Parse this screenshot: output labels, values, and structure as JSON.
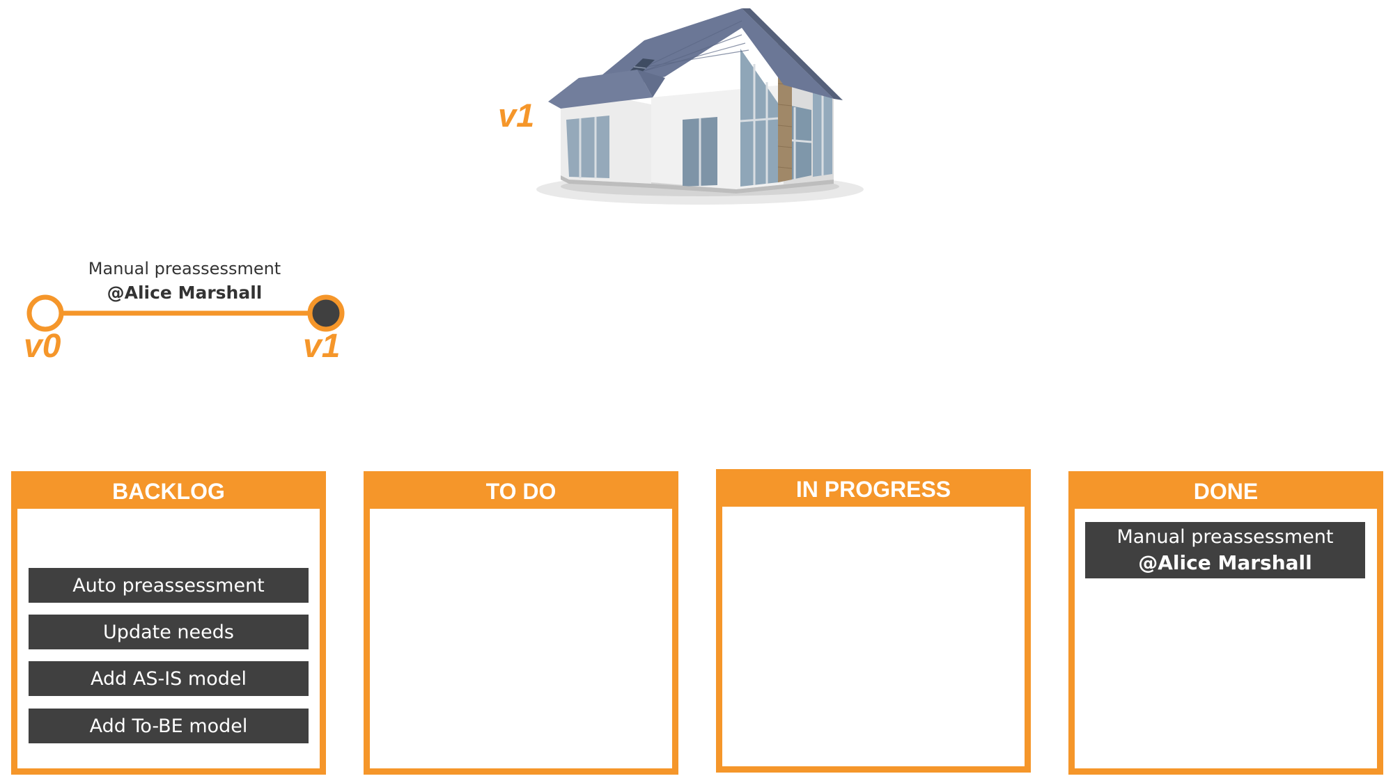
{
  "house": {
    "version_label": "v1"
  },
  "timeline": {
    "change_title": "Manual preassessment",
    "change_author": "@Alice Marshall",
    "start_label": "v0",
    "end_label": "v1",
    "accent_color": "#F5962A"
  },
  "board": {
    "columns": [
      {
        "title": "BACKLOG",
        "cards": [
          "Auto preassessment",
          "Update needs",
          "Add AS-IS model",
          "Add To-BE model"
        ]
      },
      {
        "title": "TO DO",
        "cards": []
      },
      {
        "title": "IN PROGRESS",
        "cards": []
      },
      {
        "title": "DONE",
        "cards": [
          {
            "title": "Manual preassessment",
            "author": "@Alice Marshall"
          }
        ]
      }
    ],
    "header_color": "#F5962A",
    "card_color": "#404040"
  }
}
